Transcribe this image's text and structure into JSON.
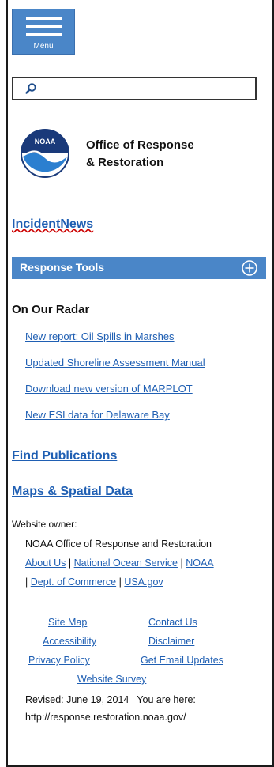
{
  "header": {
    "menu_label": "Menu",
    "search_placeholder": ""
  },
  "logo": {
    "badge_text": "NOAA",
    "org_line1": "Office of Response",
    "org_line2": "& Restoration"
  },
  "nav": {
    "incident_news": "IncidentNews",
    "response_tools": "Response Tools"
  },
  "radar": {
    "heading": "On Our Radar",
    "items": [
      "New report: Oil Spills in Marshes",
      "Updated Shoreline Assessment Manual",
      "Download new version of MARPLOT",
      "New ESI data for Delaware Bay"
    ]
  },
  "sections": {
    "find_publications": "Find Publications",
    "maps_spatial": "Maps & Spatial Data"
  },
  "owner": {
    "label": "Website owner:",
    "name": "NOAA Office of Response and Restoration",
    "about_us": "About Us",
    "national_ocean_service": "National Ocean Service",
    "noaa": "NOAA",
    "dept_commerce": "Dept. of Commerce",
    "usa_gov": "USA.gov",
    "separator": "|"
  },
  "footer": {
    "site_map": "Site Map",
    "contact_us": "Contact Us",
    "accessibility": "Accessibility",
    "disclaimer": "Disclaimer",
    "privacy_policy": "Privacy Policy",
    "email_updates": "Get Email Updates",
    "website_survey": "Website Survey"
  },
  "revised": {
    "line1": "Revised: June 19, 2014 | You are here:",
    "line2": "http://response.restoration.noaa.gov/"
  },
  "colors": {
    "accent_blue": "#4a86c8",
    "link_blue": "#1f5fb3"
  }
}
